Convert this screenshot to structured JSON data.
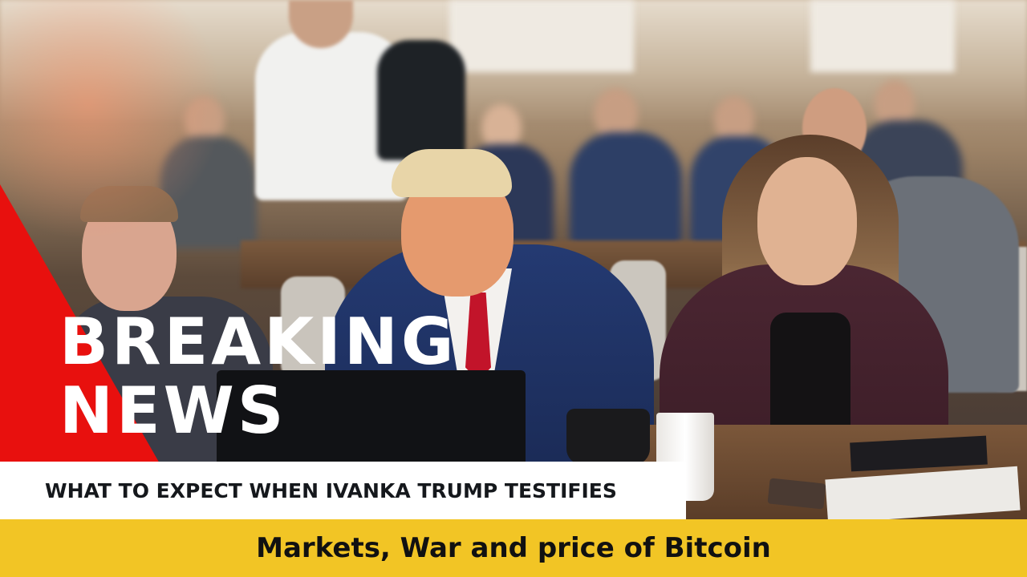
{
  "overlay": {
    "headline_line1": "BREAKING",
    "headline_line2": "NEWS",
    "subheadline": "WHAT TO EXPECT WHEN IVANKA TRUMP TESTIFIES",
    "ticker": "Markets, War and price of Bitcoin"
  },
  "colors": {
    "accent_red": "#e8100e",
    "ticker_yellow": "#f2c525",
    "subhead_bg": "#ffffff",
    "headline_text": "#ffffff",
    "body_text": "#15181c"
  }
}
